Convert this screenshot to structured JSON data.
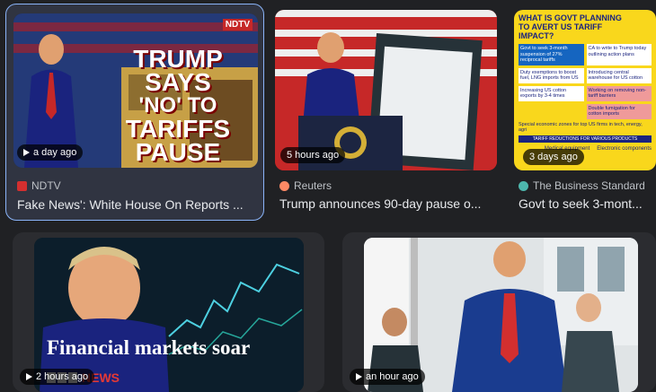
{
  "cards": [
    {
      "duration": "a day ago",
      "source": "NDTV",
      "title": "Fake News': White House On Reports ...",
      "thumb_text": [
        "TRUMP",
        "SAYS",
        "'NO' TO",
        "TARIFFS",
        "PAUSE"
      ],
      "logo": "NDTV",
      "favicon_color": "#d32f2f"
    },
    {
      "duration": "5 hours ago",
      "source": "Reuters",
      "title": "Trump announces 90-day pause o...",
      "favicon_color": "#ff8a65"
    },
    {
      "duration": "3 days ago",
      "source": "The Business Standard",
      "title": "Govt to seek 3-mont...",
      "favicon_color": "#4db6ac",
      "infographic": {
        "heading": "WHAT IS GOVT PLANNING TO AVERT US TARIFF IMPACT?",
        "items": [
          "Govt to seek 3-month suspension of 27% reciprocal tariffs",
          "CA to write to Trump today outlining action plans",
          "Duty exemptions to boost fuel, LNG imports from US",
          "Introducing central warehouse for US cotton",
          "Increasing US cotton exports by 3-4 times",
          "Working on removing non-tariff barriers",
          "Double fumigation for cotton imports",
          "Special economic zones for top US firms in tech, energy, agri"
        ],
        "footer": "TARIFF REDUCTIONS FOR VARIOUS PRODUCTS",
        "icons": [
          "Medical equipment",
          "Electronic components"
        ]
      }
    },
    {
      "duration": "2 hours ago",
      "headline": "Financial markets soar",
      "logo": "NEWS"
    },
    {
      "duration": "an hour ago"
    }
  ]
}
